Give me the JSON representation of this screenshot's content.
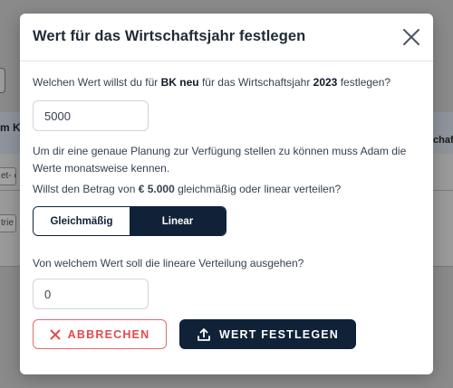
{
  "background": {
    "header_left": "m K",
    "header_right": "chaf",
    "cell_1": "et- c",
    "cell_2": "trie"
  },
  "modal": {
    "title": "Wert für das Wirtschaftsjahr festlegen",
    "question_prefix": "Welchen Wert willst du für ",
    "account": "BK neu",
    "question_middle": " für das Wirtschaftsjahr ",
    "year": "2023",
    "question_suffix": " festlegen?",
    "value": "5000",
    "info_text": "Um dir eine genaue Planung zur Verfügung stellen zu können muss Adam die Werte monatsweise kennen.",
    "distribution_prefix": "Willst den Betrag von ",
    "amount": "€ 5.000",
    "distribution_suffix": " gleichmäßig oder linear verteilen?",
    "toggle": {
      "option_even": "Gleichmäßig",
      "option_linear": "Linear",
      "selected": "Linear"
    },
    "linear_question": "Von welchem Wert soll die lineare Verteilung ausgehen?",
    "linear_start_value": "0",
    "cancel_label": "ABBRECHEN",
    "confirm_label": "WERT FESTLEGEN"
  },
  "colors": {
    "primary": "#0f2238",
    "danger": "#e14b4b",
    "overlay": "#8a8a8a"
  },
  "icons": {
    "close": "close-icon",
    "cancel": "x-icon",
    "confirm": "upload-icon"
  }
}
